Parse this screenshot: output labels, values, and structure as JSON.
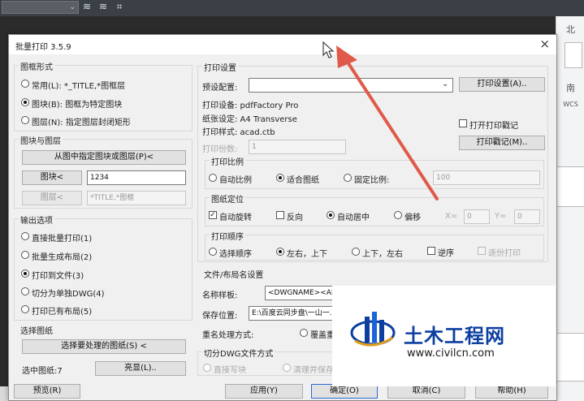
{
  "dialog": {
    "title": "批量打印 3.5.9",
    "close": "×"
  },
  "frame_style": {
    "label": "图框形式",
    "options": [
      "常用(L): *_TITLE,*图框层",
      "图块(B): 图框为特定图块",
      "图层(N): 指定图层封闭矩形"
    ],
    "selected": 1
  },
  "block_layer": {
    "label": "图块与图层",
    "pick_button": "从图中指定图块或图层(P)<",
    "block_button": "图块<",
    "block_value": "1234",
    "layer_button": "图层<",
    "layer_value": "*TITLE,*图框"
  },
  "output": {
    "label": "输出选项",
    "options": [
      "直接批量打印(1)",
      "批量生成布局(2)",
      "打印到文件(3)",
      "切分为单独DWG(4)",
      "打印已有布局(5)"
    ],
    "selected": 2
  },
  "select_drawings": {
    "label": "选择图纸",
    "select_button": "选择要处理的图纸(S) <",
    "selected_text": "选中图纸:7",
    "highlight_button": "亮显(L).."
  },
  "print_settings": {
    "label": "打印设置",
    "preset_label": "预设配置:",
    "preset_value": "",
    "settings_button": "打印设置(A)..",
    "device": "打印设备: pdfFactory Pro",
    "paper": "纸张设定: A4 Transverse",
    "style": "打印样式: acad.ctb",
    "open_stamp": "打开打印戳记",
    "copies_label": "打印份数:",
    "copies_value": "1",
    "stamp_button": "打印戳记(M).."
  },
  "scale": {
    "label": "打印比例",
    "options": [
      "自动比例",
      "适合图纸",
      "固定比例:"
    ],
    "selected": 1,
    "fixed_value": "100"
  },
  "position": {
    "label": "图纸定位",
    "auto_rotate": "自动旋转",
    "reverse": "反向",
    "center": "自动居中",
    "offset": "偏移",
    "x_label": "X=",
    "x_value": "0",
    "y_label": "Y=",
    "y_value": "0"
  },
  "order": {
    "label": "打印顺序",
    "options": [
      "选择顺序",
      "左右，上下",
      "上下，左右"
    ],
    "selected": 1,
    "reverse": "逆序",
    "copy_print": "逐份打印"
  },
  "file_naming": {
    "label": "文件/布局名设置",
    "template_label": "名称样板:",
    "template_value": "<DWGNAME><ANum",
    "save_label": "保存位置:",
    "save_value": "E:\\百度云同步盘\\一山一...",
    "rename_label": "重名处理方式:",
    "rename_option": "覆盖重"
  },
  "split": {
    "label": "切分DWG文件方式",
    "options": [
      "直接写块",
      "清理并保存"
    ]
  },
  "buttons": {
    "preview": "预览(R)",
    "apply": "应用(Y)",
    "ok": "确定(O)",
    "cancel": "取消(C)",
    "help": "帮助(H)"
  },
  "cad": {
    "north": "北",
    "south": "南",
    "wcs": "WCS"
  },
  "watermark": {
    "title": "土木工程网",
    "url": "www.civilcn.com"
  },
  "colors": {
    "accent": "#0d3fa0",
    "arrow": "#e05a4a"
  }
}
